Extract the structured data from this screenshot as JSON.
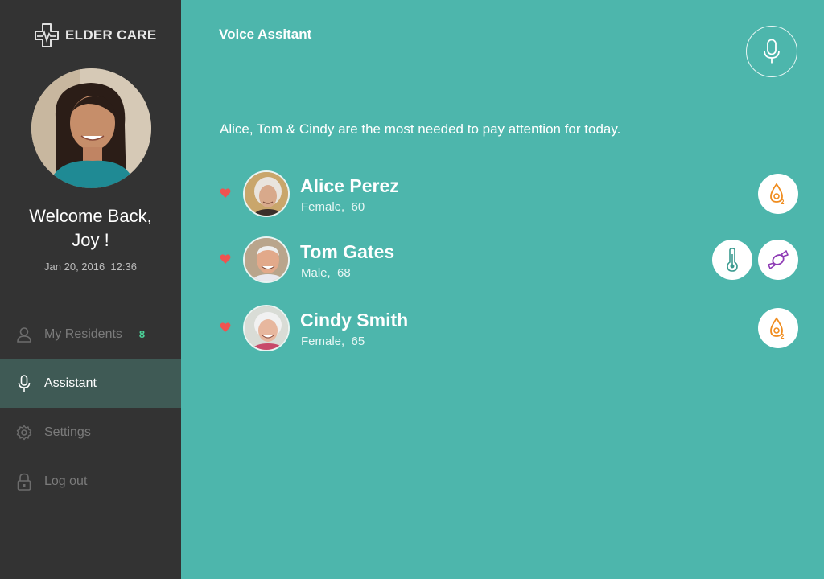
{
  "app": {
    "brand": "ELDER CARE"
  },
  "user": {
    "welcome_line1": "Welcome Back,",
    "welcome_line2": "Joy !",
    "datetime": "Jan 20, 2016  12:36"
  },
  "nav": {
    "items": [
      {
        "label": "My Residents",
        "icon": "person-icon",
        "badge": "8",
        "active": false
      },
      {
        "label": "Assistant",
        "icon": "microphone-icon",
        "active": true
      },
      {
        "label": "Settings",
        "icon": "gear-icon",
        "active": false
      },
      {
        "label": "Log out",
        "icon": "lock-icon",
        "active": false
      }
    ]
  },
  "main": {
    "title": "Voice Assitant",
    "subtitle": "Alice, Tom & Cindy are the most needed to pay attention for today.",
    "residents": [
      {
        "name": "Alice Perez",
        "gender": "Female,",
        "age": "60",
        "alerts": [
          "oxygen-icon"
        ]
      },
      {
        "name": "Tom Gates",
        "gender": "Male,",
        "age": "68",
        "alerts": [
          "thermometer-icon",
          "candy-icon"
        ]
      },
      {
        "name": "Cindy Smith",
        "gender": "Female,",
        "age": "65",
        "alerts": [
          "oxygen-icon"
        ]
      }
    ]
  },
  "colors": {
    "sidebar": "#333333",
    "main_bg": "#4db6ac",
    "active_nav": "#3f5a55",
    "badge": "#4cd39a",
    "heart": "#ef5350",
    "oxygen": "#f08c1e",
    "thermometer": "#3a9a8f",
    "candy": "#8e3bb5"
  }
}
